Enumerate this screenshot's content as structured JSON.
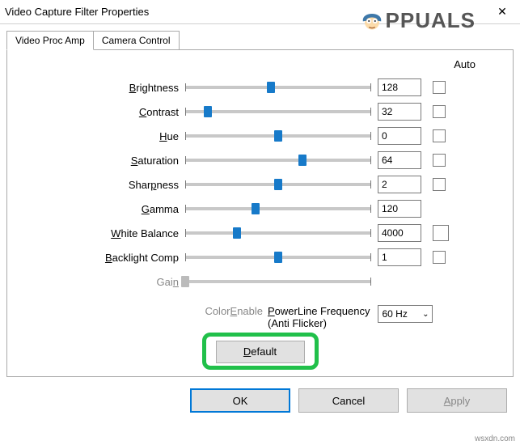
{
  "window": {
    "title": "Video Capture Filter Properties",
    "close_glyph": "✕"
  },
  "watermark": {
    "text": "PPUALS"
  },
  "footer": "wsxdn.com",
  "tabs": [
    {
      "label": "Video Proc Amp",
      "active": true
    },
    {
      "label": "Camera Control",
      "active": false
    }
  ],
  "header": {
    "auto": "Auto"
  },
  "sliders": [
    {
      "key": "brightness",
      "pre": "",
      "u": "B",
      "post": "rightness",
      "value": "128",
      "pos": 46,
      "auto": true,
      "disabled": false
    },
    {
      "key": "contrast",
      "pre": "",
      "u": "C",
      "post": "ontrast",
      "value": "32",
      "pos": 12,
      "auto": true,
      "disabled": false
    },
    {
      "key": "hue",
      "pre": "",
      "u": "H",
      "post": "ue",
      "value": "0",
      "pos": 50,
      "auto": true,
      "disabled": false
    },
    {
      "key": "saturation",
      "pre": "",
      "u": "S",
      "post": "aturation",
      "value": "64",
      "pos": 63,
      "auto": true,
      "disabled": false
    },
    {
      "key": "sharpness",
      "pre": "Shar",
      "u": "p",
      "post": "ness",
      "value": "2",
      "pos": 50,
      "auto": true,
      "disabled": false
    },
    {
      "key": "gamma",
      "pre": "",
      "u": "G",
      "post": "amma",
      "value": "120",
      "pos": 38,
      "auto": false,
      "disabled": false
    },
    {
      "key": "whitebalance",
      "pre": "",
      "u": "W",
      "post": "hite Balance",
      "value": "4000",
      "pos": 28,
      "auto": true,
      "large": true,
      "disabled": false
    },
    {
      "key": "backlight",
      "pre": "",
      "u": "B",
      "post": "acklight Comp",
      "value": "1",
      "pos": 50,
      "auto": true,
      "disabled": false
    },
    {
      "key": "gain",
      "pre": "Gai",
      "u": "n",
      "post": "",
      "value": "",
      "pos": 0,
      "auto": false,
      "disabled": true
    }
  ],
  "subrow": {
    "colorenable": {
      "pre": "Color",
      "u": "E",
      "post": "nable"
    },
    "powerline": {
      "pre": "P",
      "u": "o",
      "post1": "werLine Frequency",
      "line2": "(Anti Flicker)",
      "value": "60 Hz"
    }
  },
  "default_button": {
    "pre": "",
    "u": "D",
    "post": "efault"
  },
  "buttons": {
    "ok": "OK",
    "cancel": "Cancel",
    "apply": {
      "u": "A",
      "post": "pply"
    }
  }
}
